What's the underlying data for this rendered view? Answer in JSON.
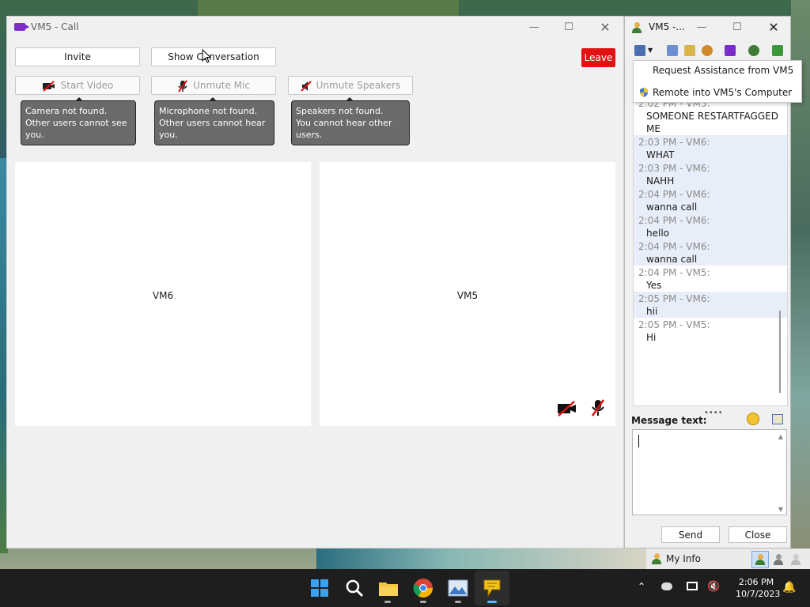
{
  "call_window": {
    "title": "VM5 - Call",
    "buttons": {
      "invite": "Invite",
      "show_conversation": "Show Conversation",
      "leave": "Leave",
      "start_video": "Start Video",
      "unmute_mic": "Unmute Mic",
      "unmute_speakers": "Unmute Speakers"
    },
    "tooltips": {
      "camera_line1": "Camera not found.",
      "camera_line2": "Other users cannot see you.",
      "mic_line1": "Microphone not found.",
      "mic_line2": "Other users cannot hear you.",
      "speakers_line1": "Speakers not found.",
      "speakers_line2": "You cannot hear other users."
    },
    "participants": [
      "VM6",
      "VM5"
    ],
    "icons": [
      "video-camera-icon",
      "camera-off-icon",
      "mic-off-icon",
      "speaker-off-icon"
    ]
  },
  "messenger": {
    "title": "VM5 -...",
    "dropdown_items": [
      "Request Assistance from VM5",
      "Remote into VM5's Computer"
    ],
    "messages": [
      {
        "time": "2:02 PM - VM5:",
        "text": "SOMEONE RESTARTFAGGED ME",
        "highlight": false
      },
      {
        "time": "2:03 PM - VM6:",
        "text": "WHAT",
        "highlight": true
      },
      {
        "time": "2:03 PM - VM6:",
        "text": "NAHH",
        "highlight": true
      },
      {
        "time": "2:04 PM - VM6:",
        "text": "wanna call",
        "highlight": true
      },
      {
        "time": "2:04 PM - VM6:",
        "text": "hello",
        "highlight": true
      },
      {
        "time": "2:04 PM - VM6:",
        "text": "wanna call",
        "highlight": true
      },
      {
        "time": "2:04 PM - VM5:",
        "text": "Yes",
        "highlight": false
      },
      {
        "time": "2:05 PM - VM6:",
        "text": "hii",
        "highlight": true
      },
      {
        "time": "2:05 PM - VM5:",
        "text": "Hi",
        "highlight": false
      }
    ],
    "message_label": "Message text:",
    "message_value": "",
    "send_label": "Send",
    "close_label": "Close",
    "my_info": "My Info"
  },
  "taskbar": {
    "time": "2:06 PM",
    "date": "10/7/2023",
    "apps": [
      "windows-start-icon",
      "search-icon",
      "file-explorer-icon",
      "chrome-icon",
      "photos-icon",
      "chat-app-icon"
    ]
  },
  "colors": {
    "leave": "#e11212",
    "accent_purple": "#7b2cc9",
    "highlight": "#e8eef9",
    "taskbar": "#1e1e1e"
  }
}
